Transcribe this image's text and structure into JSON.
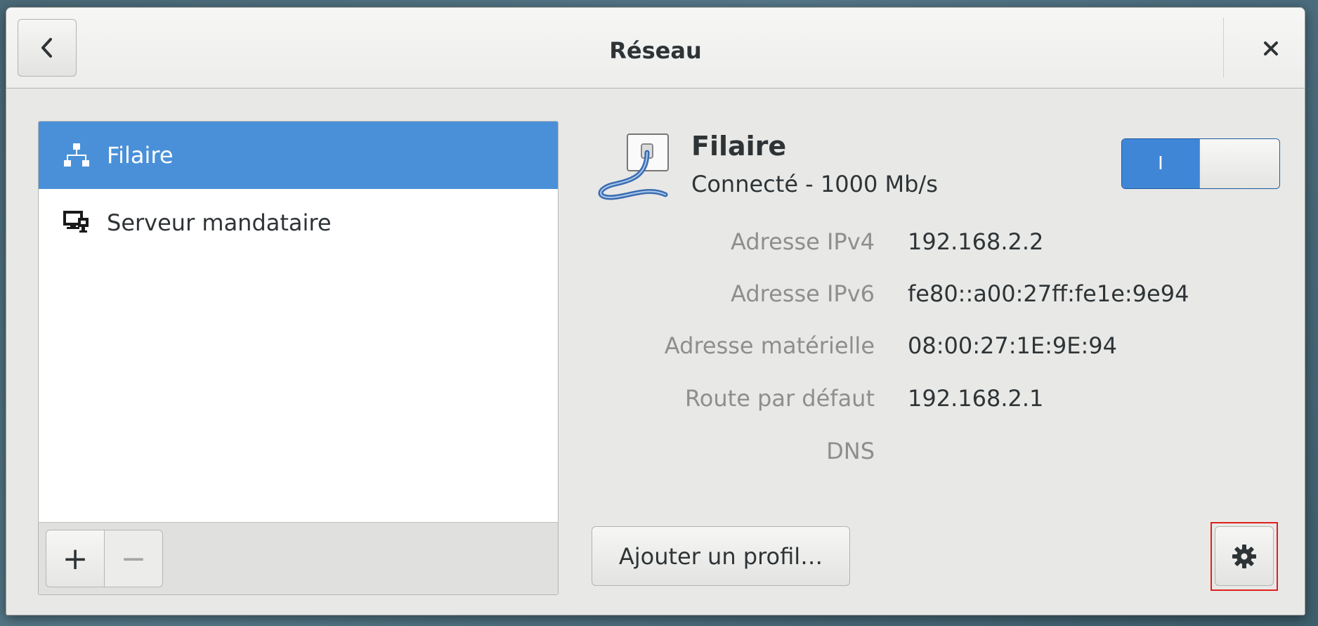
{
  "window": {
    "title": "Réseau",
    "back_icon": "chevron-left-icon",
    "close_icon": "close-icon"
  },
  "sidebar": {
    "items": [
      {
        "label": "Filaire",
        "icon": "wired-network-icon",
        "selected": true
      },
      {
        "label": "Serveur mandataire",
        "icon": "proxy-server-icon",
        "selected": false
      }
    ],
    "toolbar": {
      "add_label": "+",
      "remove_label": "−"
    }
  },
  "device": {
    "name": "Filaire",
    "status": "Connecté - 1000 Mb/s",
    "icon": "ethernet-cable-icon",
    "switch_label": "I",
    "switch_on": true
  },
  "details": [
    {
      "label": "Adresse IPv4",
      "value": "192.168.2.2"
    },
    {
      "label": "Adresse IPv6",
      "value": "fe80::a00:27ff:fe1e:9e94"
    },
    {
      "label": "Adresse matérielle",
      "value": "08:00:27:1E:9E:94"
    },
    {
      "label": "Route par défaut",
      "value": "192.168.2.1"
    },
    {
      "label": "DNS",
      "value": ""
    }
  ],
  "actions": {
    "add_profile_label": "Ajouter un profil…",
    "settings_icon": "gear-icon"
  },
  "colors": {
    "accent": "#4a90d9",
    "switch_on": "#3f86d6",
    "highlight": "#e0201c"
  }
}
